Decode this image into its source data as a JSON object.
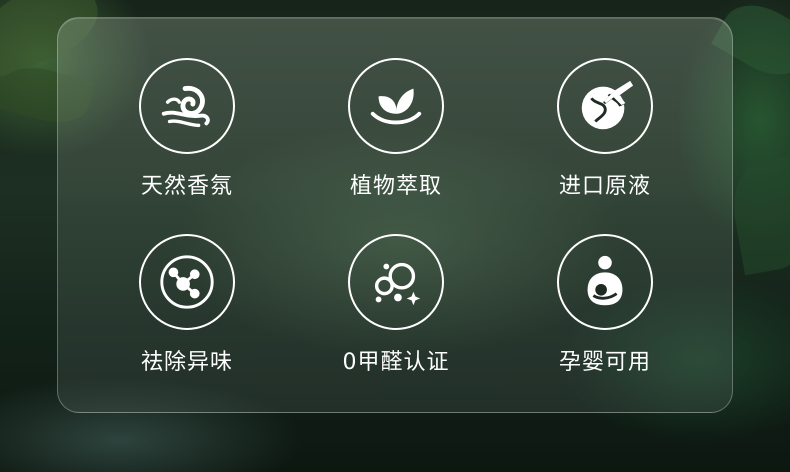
{
  "features": [
    {
      "label": "天然香氛",
      "icon": "swirl-wind-icon"
    },
    {
      "label": "植物萃取",
      "icon": "leaf-sprout-icon"
    },
    {
      "label": "进口原液",
      "icon": "globe-airplane-icon"
    },
    {
      "label": "祛除异味",
      "icon": "molecule-icon"
    },
    {
      "label": "0甲醛认证",
      "icon": "bubbles-sparkle-icon"
    },
    {
      "label": "孕婴可用",
      "icon": "mother-baby-icon"
    }
  ],
  "colors": {
    "icon": "#ffffff",
    "text": "#ffffff"
  }
}
